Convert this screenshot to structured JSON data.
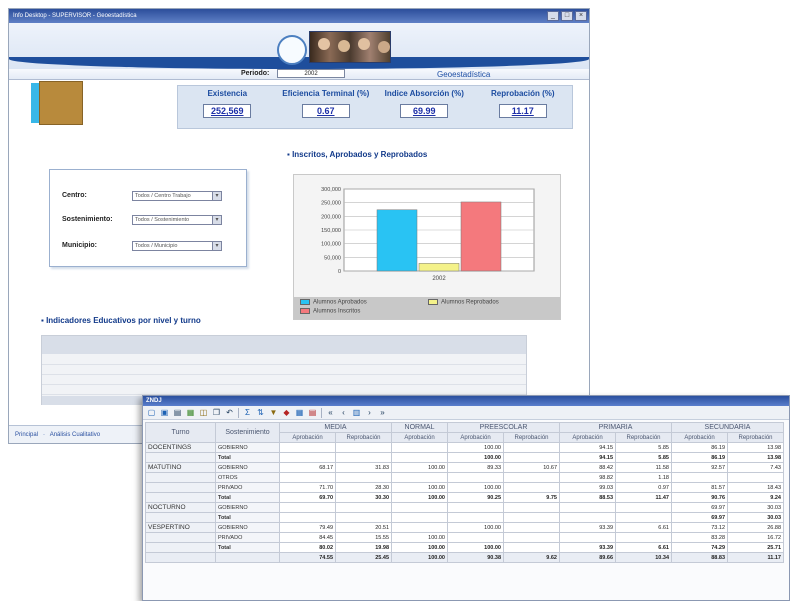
{
  "window": {
    "title": "Info Desktop - SUPERVISOR - Geoestadística"
  },
  "period": {
    "label": "Periodo:",
    "value": "2002"
  },
  "section_title": "Geoestadística",
  "kpis": [
    {
      "label": "Existencia",
      "value": "252,569"
    },
    {
      "label": "Eficiencia Terminal (%)",
      "value": "0.67"
    },
    {
      "label": "Indice Absorción (%)",
      "value": "69.99"
    },
    {
      "label": "Reprobación (%)",
      "value": "11.17"
    }
  ],
  "filters": [
    {
      "label": "Centro:",
      "value": "Todos / Centro Trabajo"
    },
    {
      "label": "Sostenimiento:",
      "value": "Todos / Sostenimiento"
    },
    {
      "label": "Municipio:",
      "value": "Todos / Municipio"
    }
  ],
  "chart_title": "Inscritos, Aprobados y Reprobados",
  "chart_data": {
    "type": "bar",
    "categories": [
      "2002"
    ],
    "series": [
      {
        "name": "Alumnos Aprobados",
        "values": [
          224000
        ],
        "color": "#29c3f3"
      },
      {
        "name": "Alumnos Reprobados",
        "values": [
          28000
        ],
        "color": "#f4f28a"
      },
      {
        "name": "Alumnos Inscritos",
        "values": [
          252569
        ],
        "color": "#f4797d"
      }
    ],
    "y_ticks": [
      "300,000",
      "250,000",
      "200,000",
      "150,000",
      "100,000",
      "50,000",
      "0"
    ],
    "ylim": [
      0,
      300000
    ],
    "grid": true,
    "legend": "bottom"
  },
  "indicadores_title": "Indicadores Educativos por nivel y turno",
  "statusbar": {
    "item1": "Principal",
    "item2": "Análisis Cualitativo"
  },
  "pivot": {
    "title": "ZNDJ",
    "headers": {
      "turno": "Turno",
      "sostenimiento": "Sostenimiento",
      "niveles": [
        "MEDIA",
        "NORMAL",
        "PREESCOLAR",
        "PRIMARIA",
        "SECUNDARIA"
      ],
      "sub": [
        "Aprobación",
        "Reprobación",
        "Aprobación",
        "Aprobación",
        "Reprobación",
        "Aprobación",
        "Reprobación",
        "Aprobación",
        "Reprobación"
      ]
    },
    "rows": [
      {
        "turno": "DOCENTINGS",
        "sost": "GOBIERNO",
        "v": [
          "",
          "",
          "",
          "100.00",
          "",
          "94.15",
          "5.85",
          "86.19",
          "13.98"
        ]
      },
      {
        "turno": "",
        "sost": "Total",
        "total": true,
        "v": [
          "",
          "",
          "",
          "100.00",
          "",
          "94.15",
          "5.85",
          "86.19",
          "13.98"
        ]
      },
      {
        "turno": "MATUTINO",
        "sost": "GOBIERNO",
        "v": [
          "68.17",
          "31.83",
          "100.00",
          "89.33",
          "10.67",
          "88.42",
          "11.58",
          "92.57",
          "7.43"
        ]
      },
      {
        "turno": "",
        "sost": "OTROS",
        "v": [
          "",
          "",
          "",
          "",
          "",
          "98.82",
          "1.18",
          "",
          ""
        ]
      },
      {
        "turno": "",
        "sost": "PRIVADO",
        "v": [
          "71.70",
          "28.30",
          "100.00",
          "100.00",
          "",
          "99.03",
          "0.97",
          "81.57",
          "18.43"
        ]
      },
      {
        "turno": "",
        "sost": "Total",
        "total": true,
        "v": [
          "69.70",
          "30.30",
          "100.00",
          "90.25",
          "9.75",
          "88.53",
          "11.47",
          "90.76",
          "9.24"
        ]
      },
      {
        "turno": "NOCTURNO",
        "sost": "GOBIERNO",
        "v": [
          "",
          "",
          "",
          "",
          "",
          "",
          "",
          "69.97",
          "30.03"
        ]
      },
      {
        "turno": "",
        "sost": "Total",
        "total": true,
        "v": [
          "",
          "",
          "",
          "",
          "",
          "",
          "",
          "69.97",
          "30.03"
        ]
      },
      {
        "turno": "VESPERTINO",
        "sost": "GOBIERNO",
        "v": [
          "79.49",
          "20.51",
          "",
          "100.00",
          "",
          "93.39",
          "6.61",
          "73.12",
          "26.88"
        ]
      },
      {
        "turno": "",
        "sost": "PRIVADO",
        "v": [
          "84.45",
          "15.55",
          "100.00",
          "",
          "",
          "",
          "",
          "83.28",
          "16.72"
        ]
      },
      {
        "turno": "",
        "sost": "Total",
        "total": true,
        "v": [
          "80.02",
          "19.98",
          "100.00",
          "100.00",
          "",
          "93.39",
          "6.61",
          "74.29",
          "25.71"
        ]
      },
      {
        "turno": "",
        "sost": "",
        "grand": true,
        "v": [
          "74.55",
          "25.45",
          "100.00",
          "90.38",
          "9.62",
          "89.66",
          "10.34",
          "88.83",
          "11.17"
        ]
      }
    ]
  }
}
